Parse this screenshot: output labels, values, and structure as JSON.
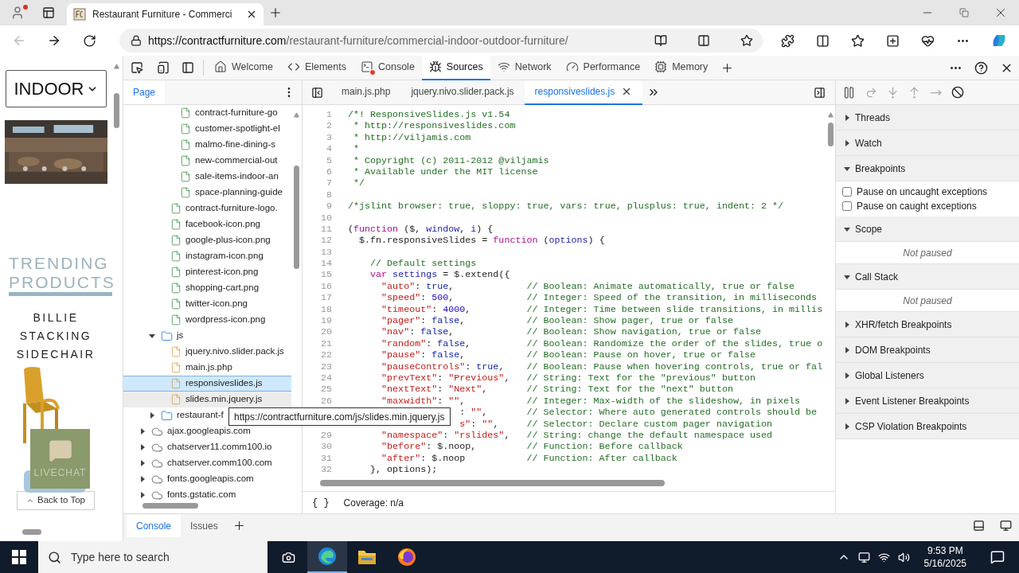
{
  "browser": {
    "tab": {
      "title": "Restaurant Furniture - Commerci"
    },
    "address": {
      "scheme": "https://",
      "host": "contractfurniture.com",
      "path": "/restaurant-furniture/commercial-indoor-outdoor-furniture/"
    }
  },
  "page": {
    "select": "INDOOR",
    "heading": [
      "TRENDING",
      "PRODUCTS"
    ],
    "product": "BILLIE STACKING SIDECHAIR",
    "chat_label": "LIVECHAT",
    "back_to_top": "Back to Top"
  },
  "devtools": {
    "tabs": [
      {
        "label": "Welcome",
        "kind": "home",
        "badge": false,
        "selected": false
      },
      {
        "label": "Elements",
        "kind": "code",
        "badge": false,
        "selected": false
      },
      {
        "label": "Console",
        "kind": "console",
        "badge": true,
        "selected": false
      },
      {
        "label": "Sources",
        "kind": "bug",
        "badge": false,
        "selected": true
      },
      {
        "label": "Network",
        "kind": "wifi",
        "badge": false,
        "selected": false
      },
      {
        "label": "Performance",
        "kind": "gauge",
        "badge": false,
        "selected": false
      },
      {
        "label": "Memory",
        "kind": "chip",
        "badge": false,
        "selected": false
      }
    ],
    "navigator": {
      "tabs": [
        {
          "label": "Page",
          "selected": true
        }
      ],
      "tree": [
        {
          "children": [
            {
              "children": [
                {
                  "children": [
                    {
                      "label": "contract-furniture-go",
                      "selected": false,
                      "hovered": false
                    },
                    {
                      "label": "customer-spotlight-el",
                      "selected": false,
                      "hovered": false
                    },
                    {
                      "label": "malmo-fine-dining-s",
                      "selected": false,
                      "hovered": false
                    },
                    {
                      "label": "new-commercial-out",
                      "selected": false,
                      "hovered": false
                    },
                    {
                      "label": "sale-items-indoor-an",
                      "selected": false,
                      "hovered": false
                    },
                    {
                      "label": "space-planning-guide",
                      "selected": false,
                      "hovered": false
                    }
                  ]
                },
                {
                  "label": "contract-furniture-logo.",
                  "selected": false,
                  "hovered": false
                },
                {
                  "label": "facebook-icon.png",
                  "selected": false,
                  "hovered": false
                },
                {
                  "label": "google-plus-icon.png",
                  "selected": false,
                  "hovered": false
                },
                {
                  "label": "instagram-icon.png",
                  "selected": false,
                  "hovered": false
                },
                {
                  "label": "pinterest-icon.png",
                  "selected": false,
                  "hovered": false
                },
                {
                  "label": "shopping-cart.png",
                  "selected": false,
                  "hovered": false
                },
                {
                  "label": "twitter-icon.png",
                  "selected": false,
                  "hovered": false
                },
                {
                  "label": "wordpress-icon.png",
                  "selected": false,
                  "hovered": false
                }
              ]
            },
            {
              "label": "js",
              "kind": "folder",
              "expanded": true,
              "selected": false,
              "hovered": false,
              "children": [
                {
                  "label": "jquery.nivo.slider.pack.js",
                  "kind": "script",
                  "selected": false,
                  "hovered": false
                },
                {
                  "label": "main.js.php",
                  "kind": "script",
                  "selected": false,
                  "hovered": false
                },
                {
                  "label": "responsiveslides.js",
                  "kind": "script",
                  "selected": true,
                  "hovered": false
                },
                {
                  "label": "slides.min.jquery.js",
                  "kind": "script",
                  "selected": false,
                  "hovered": true
                }
              ]
            },
            {
              "label": "restaurant-f",
              "kind": "folder",
              "expanded": false,
              "selected": false,
              "hovered": false
            }
          ]
        },
        {
          "label": "ajax.googleapis.com",
          "kind": "domain",
          "expanded": false,
          "selected": false,
          "hovered": false
        },
        {
          "label": "chatserver11.comm100.io",
          "kind": "domain",
          "expanded": false,
          "selected": false,
          "hovered": false
        },
        {
          "label": "chatserver.comm100.com",
          "kind": "domain",
          "expanded": false,
          "selected": false,
          "hovered": false
        },
        {
          "label": "fonts.googleapis.com",
          "kind": "domain",
          "expanded": false,
          "selected": false,
          "hovered": false
        },
        {
          "label": "fonts.gstatic.com",
          "kind": "domain",
          "expanded": false,
          "selected": false,
          "hovered": false
        }
      ]
    },
    "editor": {
      "tabs": [
        {
          "label": "main.js.php",
          "selected": false
        },
        {
          "label": "jquery.nivo.slider.pack.js",
          "selected": false
        },
        {
          "label": "responsiveslides.js",
          "selected": true
        }
      ],
      "lines": [
        {
          "number": "1",
          "tokens": [
            {
              "kind": "comment",
              "t": "/*! ResponsiveSlides.js v1.54"
            }
          ]
        },
        {
          "number": "2",
          "tokens": [
            {
              "kind": "comment",
              "t": " * http://responsiveslides.com"
            }
          ]
        },
        {
          "number": "3",
          "tokens": [
            {
              "kind": "comment",
              "t": " * http://viljamis.com"
            }
          ]
        },
        {
          "number": "4",
          "tokens": [
            {
              "kind": "comment",
              "t": " *"
            }
          ]
        },
        {
          "number": "5",
          "tokens": [
            {
              "kind": "comment",
              "t": " * Copyright (c) 2011-2012 @viljamis"
            }
          ]
        },
        {
          "number": "6",
          "tokens": [
            {
              "kind": "comment",
              "t": " * Available under the MIT license"
            }
          ]
        },
        {
          "number": "7",
          "tokens": [
            {
              "kind": "comment",
              "t": " */"
            }
          ]
        },
        {
          "number": "8"
        },
        {
          "number": "9",
          "tokens": [
            {
              "kind": "comment",
              "t": "/*jslint browser: true, sloppy: true, vars: true, plusplus: true, indent: 2 */"
            }
          ]
        },
        {
          "number": "10"
        },
        {
          "number": "11",
          "tokens": [
            {
              "kind": "plain",
              "t": "("
            },
            {
              "kind": "keyword",
              "t": "function"
            },
            {
              "kind": "plain",
              "t": " ($, "
            },
            {
              "kind": "variable",
              "t": "window"
            },
            {
              "kind": "plain",
              "t": ", "
            },
            {
              "kind": "variable",
              "t": "i"
            },
            {
              "kind": "plain",
              "t": ") {"
            }
          ]
        },
        {
          "number": "12",
          "tokens": [
            {
              "kind": "plain",
              "t": "  $.fn.responsiveSlides = "
            },
            {
              "kind": "keyword",
              "t": "function"
            },
            {
              "kind": "plain",
              "t": " ("
            },
            {
              "kind": "variable",
              "t": "options"
            },
            {
              "kind": "plain",
              "t": ") {"
            }
          ]
        },
        {
          "number": "13"
        },
        {
          "number": "14",
          "tokens": [
            {
              "kind": "comment",
              "t": "    // Default settings"
            }
          ]
        },
        {
          "number": "15",
          "tokens": [
            {
              "kind": "keyword",
              "t": "    var"
            },
            {
              "kind": "variable",
              "t": " settings"
            },
            {
              "kind": "plain",
              "t": " = $.extend({"
            }
          ]
        },
        {
          "number": "16",
          "tokens": [
            {
              "kind": "string",
              "t": "      \"auto\""
            },
            {
              "kind": "plain",
              "t": ": "
            },
            {
              "kind": "atom",
              "t": "true"
            },
            {
              "kind": "plain",
              "t": ","
            }
          ],
          "comment": "// Boolean: Animate automatically, true or false"
        },
        {
          "number": "17",
          "tokens": [
            {
              "kind": "string",
              "t": "      \"speed\""
            },
            {
              "kind": "plain",
              "t": ": "
            },
            {
              "kind": "number",
              "t": "500"
            },
            {
              "kind": "plain",
              "t": ","
            }
          ],
          "comment": "// Integer: Speed of the transition, in milliseconds"
        },
        {
          "number": "18",
          "tokens": [
            {
              "kind": "string",
              "t": "      \"timeout\""
            },
            {
              "kind": "plain",
              "t": ": "
            },
            {
              "kind": "number",
              "t": "4000"
            },
            {
              "kind": "plain",
              "t": ","
            }
          ],
          "comment": "// Integer: Time between slide transitions, in millis"
        },
        {
          "number": "19",
          "tokens": [
            {
              "kind": "string",
              "t": "      \"pager\""
            },
            {
              "kind": "plain",
              "t": ": "
            },
            {
              "kind": "atom",
              "t": "false"
            },
            {
              "kind": "plain",
              "t": ","
            }
          ],
          "comment": "// Boolean: Show pager, true or false"
        },
        {
          "number": "20",
          "tokens": [
            {
              "kind": "string",
              "t": "      \"nav\""
            },
            {
              "kind": "plain",
              "t": ": "
            },
            {
              "kind": "atom",
              "t": "false"
            },
            {
              "kind": "plain",
              "t": ","
            }
          ],
          "comment": "// Boolean: Show navigation, true or false"
        },
        {
          "number": "21",
          "tokens": [
            {
              "kind": "string",
              "t": "      \"random\""
            },
            {
              "kind": "plain",
              "t": ": "
            },
            {
              "kind": "atom",
              "t": "false"
            },
            {
              "kind": "plain",
              "t": ","
            }
          ],
          "comment": "// Boolean: Randomize the order of the slides, true o"
        },
        {
          "number": "22",
          "tokens": [
            {
              "kind": "string",
              "t": "      \"pause\""
            },
            {
              "kind": "plain",
              "t": ": "
            },
            {
              "kind": "atom",
              "t": "false"
            },
            {
              "kind": "plain",
              "t": ","
            }
          ],
          "comment": "// Boolean: Pause on hover, true or false"
        },
        {
          "number": "23",
          "tokens": [
            {
              "kind": "string",
              "t": "      \"pauseControls\""
            },
            {
              "kind": "plain",
              "t": ": "
            },
            {
              "kind": "atom",
              "t": "true"
            },
            {
              "kind": "plain",
              "t": ","
            }
          ],
          "comment": "// Boolean: Pause when hovering controls, true or fal"
        },
        {
          "number": "24",
          "tokens": [
            {
              "kind": "string",
              "t": "      \"prevText\""
            },
            {
              "kind": "plain",
              "t": ": "
            },
            {
              "kind": "string",
              "t": "\"Previous\""
            },
            {
              "kind": "plain",
              "t": ","
            }
          ],
          "comment": "// String: Text for the \"previous\" button"
        },
        {
          "number": "25",
          "tokens": [
            {
              "kind": "string",
              "t": "      \"nextText\""
            },
            {
              "kind": "plain",
              "t": ": "
            },
            {
              "kind": "string",
              "t": "\"Next\""
            },
            {
              "kind": "plain",
              "t": ","
            }
          ],
          "comment": "// String: Text for the \"next\" button"
        },
        {
          "number": "26",
          "tokens": [
            {
              "kind": "string",
              "t": "      \"maxwidth\""
            },
            {
              "kind": "plain",
              "t": ": "
            },
            {
              "kind": "string",
              "t": "\"\""
            },
            {
              "kind": "plain",
              "t": ","
            }
          ],
          "comment": "// Integer: Max-width of the slideshow, in pixels"
        },
        {
          "tokens": [
            {
              "kind": "plain",
              "t": "                    : "
            },
            {
              "kind": "string",
              "t": "\"\""
            },
            {
              "kind": "plain",
              "t": ","
            }
          ],
          "comment": "// Selector: Where auto generated controls should be"
        },
        {
          "tokens": [
            {
              "kind": "string",
              "t": "                    s\""
            },
            {
              "kind": "plain",
              "t": ": "
            },
            {
              "kind": "string",
              "t": "\"\""
            },
            {
              "kind": "plain",
              "t": ","
            }
          ],
          "comment": "// Selector: Declare custom pager navigation"
        },
        {
          "number": "29",
          "tokens": [
            {
              "kind": "string",
              "t": "      \"namespace\""
            },
            {
              "kind": "plain",
              "t": ": "
            },
            {
              "kind": "string",
              "t": "\"rslides\""
            },
            {
              "kind": "plain",
              "t": ","
            }
          ],
          "comment": "// String: change the default namespace used"
        },
        {
          "number": "30",
          "tokens": [
            {
              "kind": "string",
              "t": "      \"before\""
            },
            {
              "kind": "plain",
              "t": ": $.noop,"
            }
          ],
          "comment": "// Function: Before callback"
        },
        {
          "number": "31",
          "tokens": [
            {
              "kind": "string",
              "t": "      \"after\""
            },
            {
              "kind": "plain",
              "t": ": $.noop"
            }
          ],
          "comment": "// Function: After callback"
        },
        {
          "number": "32",
          "tokens": [
            {
              "kind": "plain",
              "t": "    }, options);"
            }
          ]
        }
      ],
      "status": {
        "braces": "{ }",
        "coverage": "Coverage: n/a"
      }
    },
    "debugger": {
      "sections": [
        {
          "title": "Threads",
          "expanded": false
        },
        {
          "title": "Watch",
          "expanded": false
        },
        {
          "title": "Breakpoints",
          "expanded": true,
          "items": [
            {
              "label": "Pause on uncaught exceptions",
              "checked": false
            },
            {
              "label": "Pause on caught exceptions",
              "checked": false
            }
          ]
        },
        {
          "title": "Scope",
          "expanded": true,
          "message": "Not paused"
        },
        {
          "title": "Call Stack",
          "expanded": true,
          "message": "Not paused"
        },
        {
          "title": "XHR/fetch Breakpoints",
          "expanded": false
        },
        {
          "title": "DOM Breakpoints",
          "expanded": false
        },
        {
          "title": "Global Listeners",
          "expanded": false
        },
        {
          "title": "Event Listener Breakpoints",
          "expanded": false
        },
        {
          "title": "CSP Violation Breakpoints",
          "expanded": false
        }
      ]
    },
    "drawer": {
      "tabs": [
        {
          "label": "Console",
          "selected": true
        },
        {
          "label": "Issues",
          "selected": false
        }
      ]
    },
    "tooltip": "https://contractfurniture.com/js/slides.min.jquery.js"
  },
  "taskbar": {
    "search_placeholder": "Type here to search",
    "time": "9:53 PM",
    "date": "5/16/2025"
  }
}
